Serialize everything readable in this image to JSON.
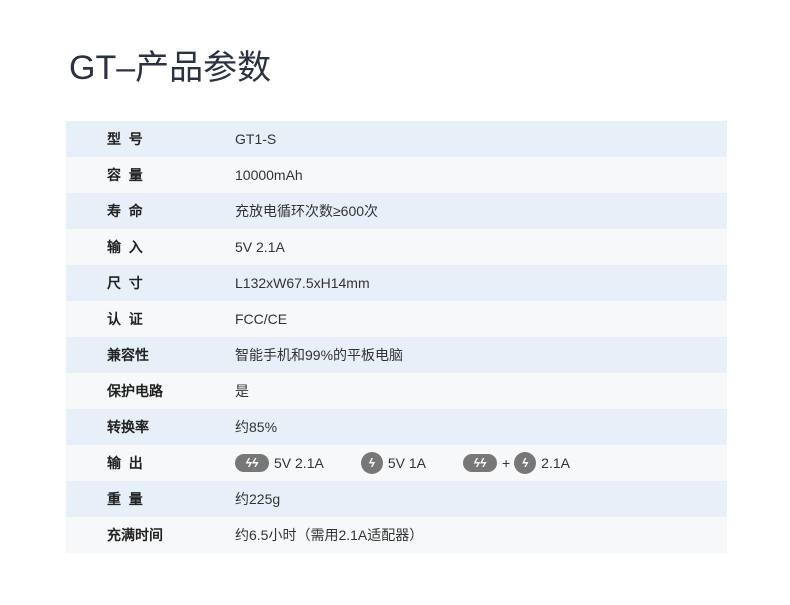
{
  "title": "GT–产品参数",
  "specs": [
    {
      "label": "型  号",
      "value": "GT1-S"
    },
    {
      "label": "容  量",
      "value": "10000mAh"
    },
    {
      "label": "寿  命",
      "value": "充放电循环次数≥600次"
    },
    {
      "label": "输  入",
      "value": "5V 2.1A"
    },
    {
      "label": "尺  寸",
      "value": "L132xW67.5xH14mm"
    },
    {
      "label": "认  证",
      "value": "FCC/CE"
    },
    {
      "label": "兼容性",
      "value": "智能手机和99%的平板电脑"
    },
    {
      "label": "保护电路",
      "value": "是"
    },
    {
      "label": "转换率",
      "value": "约85%"
    },
    {
      "label": "输  出",
      "outputs": [
        {
          "icon": "double-bolt-icon",
          "value": "5V 2.1A"
        },
        {
          "icon": "bolt-icon",
          "value": "5V 1A"
        },
        {
          "icon": "double-bolt-plus-bolt-icon",
          "plus": "+",
          "value": "2.1A"
        }
      ]
    },
    {
      "label": "重  量",
      "value": "约225g"
    },
    {
      "label": "充满时间",
      "value": "约6.5小时（需用2.1A适配器）"
    }
  ],
  "colors": {
    "row_odd": "#e7f0f8",
    "row_even": "#f7f8f9",
    "icon": "#777777"
  }
}
